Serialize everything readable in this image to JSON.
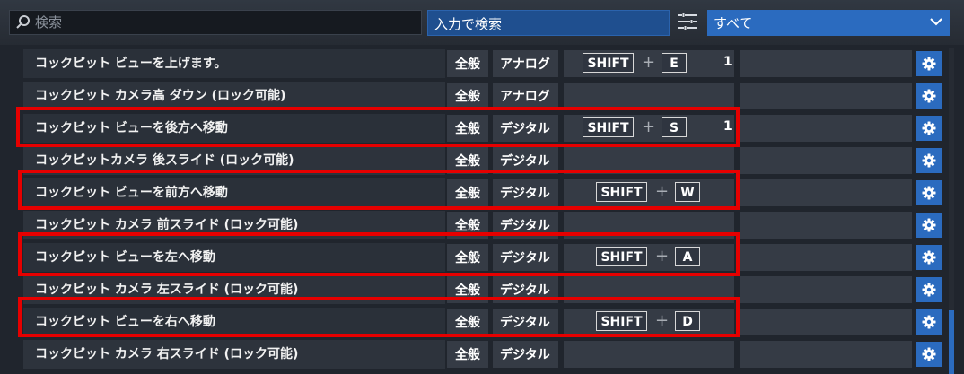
{
  "search": {
    "placeholder": "検索"
  },
  "input_search_label": "入力で検索",
  "filter": {
    "selected": "すべて"
  },
  "rows": [
    {
      "name": "コックピット ビューを上げます。",
      "category": "全般",
      "type": "アナログ",
      "keys": [
        "SHIFT",
        "E"
      ],
      "value": "1"
    },
    {
      "name": "コックピット カメラ高 ダウン (ロック可能)",
      "category": "全般",
      "type": "アナログ",
      "keys": [],
      "value": ""
    },
    {
      "name": "コックピット ビューを後方へ移動",
      "category": "全般",
      "type": "デジタル",
      "keys": [
        "SHIFT",
        "S"
      ],
      "value": "1"
    },
    {
      "name": "コックピットカメラ 後スライド (ロック可能)",
      "category": "全般",
      "type": "デジタル",
      "keys": [],
      "value": ""
    },
    {
      "name": "コックピット ビューを前方へ移動",
      "category": "全般",
      "type": "デジタル",
      "keys": [
        "SHIFT",
        "W"
      ],
      "value": ""
    },
    {
      "name": "コックピット カメラ 前スライド (ロック可能)",
      "category": "全般",
      "type": "デジタル",
      "keys": [],
      "value": ""
    },
    {
      "name": "コックピット ビューを左へ移動",
      "category": "全般",
      "type": "デジタル",
      "keys": [
        "SHIFT",
        "A"
      ],
      "value": ""
    },
    {
      "name": "コックピット カメラ 左スライド (ロック可能)",
      "category": "全般",
      "type": "デジタル",
      "keys": [],
      "value": ""
    },
    {
      "name": "コックピット ビューを右へ移動",
      "category": "全般",
      "type": "デジタル",
      "keys": [
        "SHIFT",
        "D"
      ],
      "value": ""
    },
    {
      "name": "コックピット カメラ 右スライド (ロック可能)",
      "category": "全般",
      "type": "デジタル",
      "keys": [],
      "value": ""
    }
  ],
  "plus_symbol": "+",
  "icons": {
    "search": "search-icon",
    "filter": "filter-list-icon",
    "dropdown": "chevron-down-icon",
    "settings": "gear-icon"
  },
  "colors": {
    "accent": "#2b6bbf",
    "highlight": "#e60000",
    "background": "#20252d"
  }
}
